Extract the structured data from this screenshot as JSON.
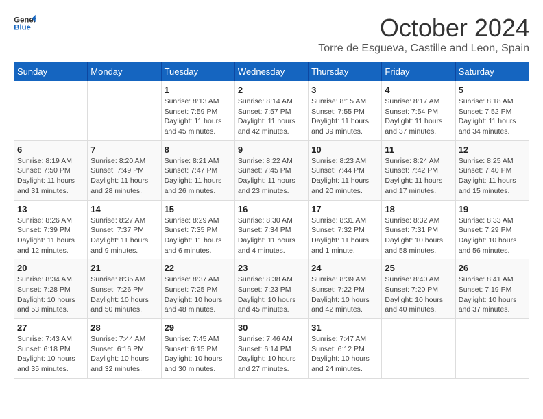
{
  "header": {
    "logo_line1": "General",
    "logo_line2": "Blue",
    "month_year": "October 2024",
    "location": "Torre de Esgueva, Castille and Leon, Spain"
  },
  "days_of_week": [
    "Sunday",
    "Monday",
    "Tuesday",
    "Wednesday",
    "Thursday",
    "Friday",
    "Saturday"
  ],
  "weeks": [
    [
      {
        "day": "",
        "detail": ""
      },
      {
        "day": "",
        "detail": ""
      },
      {
        "day": "1",
        "detail": "Sunrise: 8:13 AM\nSunset: 7:59 PM\nDaylight: 11 hours and 45 minutes."
      },
      {
        "day": "2",
        "detail": "Sunrise: 8:14 AM\nSunset: 7:57 PM\nDaylight: 11 hours and 42 minutes."
      },
      {
        "day": "3",
        "detail": "Sunrise: 8:15 AM\nSunset: 7:55 PM\nDaylight: 11 hours and 39 minutes."
      },
      {
        "day": "4",
        "detail": "Sunrise: 8:17 AM\nSunset: 7:54 PM\nDaylight: 11 hours and 37 minutes."
      },
      {
        "day": "5",
        "detail": "Sunrise: 8:18 AM\nSunset: 7:52 PM\nDaylight: 11 hours and 34 minutes."
      }
    ],
    [
      {
        "day": "6",
        "detail": "Sunrise: 8:19 AM\nSunset: 7:50 PM\nDaylight: 11 hours and 31 minutes."
      },
      {
        "day": "7",
        "detail": "Sunrise: 8:20 AM\nSunset: 7:49 PM\nDaylight: 11 hours and 28 minutes."
      },
      {
        "day": "8",
        "detail": "Sunrise: 8:21 AM\nSunset: 7:47 PM\nDaylight: 11 hours and 26 minutes."
      },
      {
        "day": "9",
        "detail": "Sunrise: 8:22 AM\nSunset: 7:45 PM\nDaylight: 11 hours and 23 minutes."
      },
      {
        "day": "10",
        "detail": "Sunrise: 8:23 AM\nSunset: 7:44 PM\nDaylight: 11 hours and 20 minutes."
      },
      {
        "day": "11",
        "detail": "Sunrise: 8:24 AM\nSunset: 7:42 PM\nDaylight: 11 hours and 17 minutes."
      },
      {
        "day": "12",
        "detail": "Sunrise: 8:25 AM\nSunset: 7:40 PM\nDaylight: 11 hours and 15 minutes."
      }
    ],
    [
      {
        "day": "13",
        "detail": "Sunrise: 8:26 AM\nSunset: 7:39 PM\nDaylight: 11 hours and 12 minutes."
      },
      {
        "day": "14",
        "detail": "Sunrise: 8:27 AM\nSunset: 7:37 PM\nDaylight: 11 hours and 9 minutes."
      },
      {
        "day": "15",
        "detail": "Sunrise: 8:29 AM\nSunset: 7:35 PM\nDaylight: 11 hours and 6 minutes."
      },
      {
        "day": "16",
        "detail": "Sunrise: 8:30 AM\nSunset: 7:34 PM\nDaylight: 11 hours and 4 minutes."
      },
      {
        "day": "17",
        "detail": "Sunrise: 8:31 AM\nSunset: 7:32 PM\nDaylight: 11 hours and 1 minute."
      },
      {
        "day": "18",
        "detail": "Sunrise: 8:32 AM\nSunset: 7:31 PM\nDaylight: 10 hours and 58 minutes."
      },
      {
        "day": "19",
        "detail": "Sunrise: 8:33 AM\nSunset: 7:29 PM\nDaylight: 10 hours and 56 minutes."
      }
    ],
    [
      {
        "day": "20",
        "detail": "Sunrise: 8:34 AM\nSunset: 7:28 PM\nDaylight: 10 hours and 53 minutes."
      },
      {
        "day": "21",
        "detail": "Sunrise: 8:35 AM\nSunset: 7:26 PM\nDaylight: 10 hours and 50 minutes."
      },
      {
        "day": "22",
        "detail": "Sunrise: 8:37 AM\nSunset: 7:25 PM\nDaylight: 10 hours and 48 minutes."
      },
      {
        "day": "23",
        "detail": "Sunrise: 8:38 AM\nSunset: 7:23 PM\nDaylight: 10 hours and 45 minutes."
      },
      {
        "day": "24",
        "detail": "Sunrise: 8:39 AM\nSunset: 7:22 PM\nDaylight: 10 hours and 42 minutes."
      },
      {
        "day": "25",
        "detail": "Sunrise: 8:40 AM\nSunset: 7:20 PM\nDaylight: 10 hours and 40 minutes."
      },
      {
        "day": "26",
        "detail": "Sunrise: 8:41 AM\nSunset: 7:19 PM\nDaylight: 10 hours and 37 minutes."
      }
    ],
    [
      {
        "day": "27",
        "detail": "Sunrise: 7:43 AM\nSunset: 6:18 PM\nDaylight: 10 hours and 35 minutes."
      },
      {
        "day": "28",
        "detail": "Sunrise: 7:44 AM\nSunset: 6:16 PM\nDaylight: 10 hours and 32 minutes."
      },
      {
        "day": "29",
        "detail": "Sunrise: 7:45 AM\nSunset: 6:15 PM\nDaylight: 10 hours and 30 minutes."
      },
      {
        "day": "30",
        "detail": "Sunrise: 7:46 AM\nSunset: 6:14 PM\nDaylight: 10 hours and 27 minutes."
      },
      {
        "day": "31",
        "detail": "Sunrise: 7:47 AM\nSunset: 6:12 PM\nDaylight: 10 hours and 24 minutes."
      },
      {
        "day": "",
        "detail": ""
      },
      {
        "day": "",
        "detail": ""
      }
    ]
  ]
}
